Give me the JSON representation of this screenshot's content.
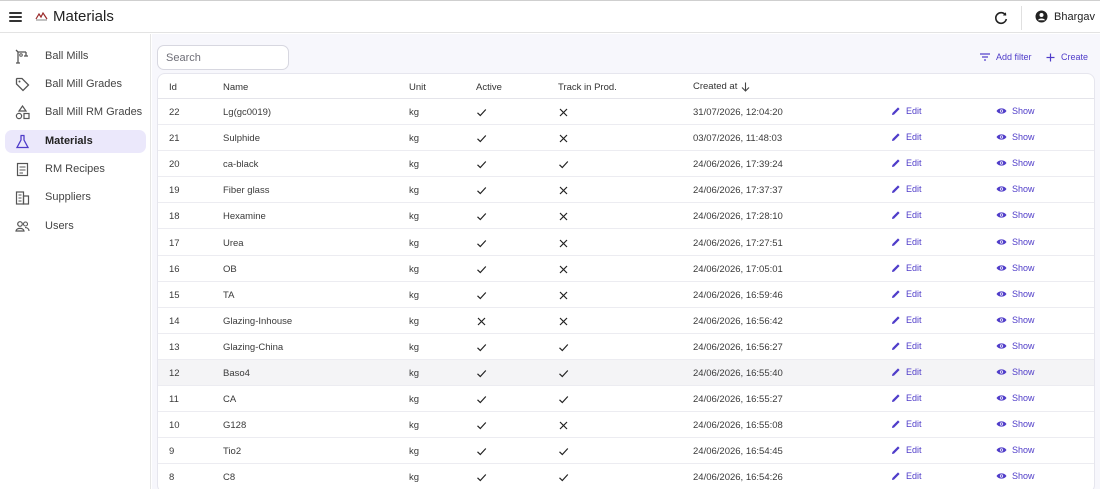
{
  "app": {
    "title": "Materials",
    "user": "Bhargav"
  },
  "sidebar": {
    "items": [
      {
        "label": "Ball Mills",
        "icon": "crane-icon",
        "active": false
      },
      {
        "label": "Ball Mill Grades",
        "icon": "tag-icon",
        "active": false
      },
      {
        "label": "Ball Mill RM Grades",
        "icon": "shapes-icon",
        "active": false
      },
      {
        "label": "Materials",
        "icon": "flask-icon",
        "active": true
      },
      {
        "label": "RM Recipes",
        "icon": "receipt-icon",
        "active": false
      },
      {
        "label": "Suppliers",
        "icon": "building-icon",
        "active": false
      },
      {
        "label": "Users",
        "icon": "people-icon",
        "active": false
      }
    ]
  },
  "search": {
    "placeholder": "Search",
    "value": ""
  },
  "toolbar": {
    "add_filter": "Add filter",
    "create": "Create"
  },
  "table": {
    "columns": {
      "id": "Id",
      "name": "Name",
      "unit": "Unit",
      "active": "Active",
      "track": "Track in Prod.",
      "created": "Created at"
    },
    "sort_column": "created",
    "sort_direction": "desc",
    "edit_label": "Edit",
    "show_label": "Show",
    "highlighted_row_id": "12",
    "rows": [
      {
        "id": "22",
        "name": "Lg(gc0019)",
        "unit": "kg",
        "active": true,
        "track": false,
        "created": "31/07/2026, 12:04:20"
      },
      {
        "id": "21",
        "name": "Sulphide",
        "unit": "kg",
        "active": true,
        "track": false,
        "created": "03/07/2026, 11:48:03"
      },
      {
        "id": "20",
        "name": "ca-black",
        "unit": "kg",
        "active": true,
        "track": true,
        "created": "24/06/2026, 17:39:24"
      },
      {
        "id": "19",
        "name": "Fiber glass",
        "unit": "kg",
        "active": true,
        "track": false,
        "created": "24/06/2026, 17:37:37"
      },
      {
        "id": "18",
        "name": "Hexamine",
        "unit": "kg",
        "active": true,
        "track": false,
        "created": "24/06/2026, 17:28:10"
      },
      {
        "id": "17",
        "name": "Urea",
        "unit": "kg",
        "active": true,
        "track": false,
        "created": "24/06/2026, 17:27:51"
      },
      {
        "id": "16",
        "name": "OB",
        "unit": "kg",
        "active": true,
        "track": false,
        "created": "24/06/2026, 17:05:01"
      },
      {
        "id": "15",
        "name": "TA",
        "unit": "kg",
        "active": true,
        "track": false,
        "created": "24/06/2026, 16:59:46"
      },
      {
        "id": "14",
        "name": "Glazing-Inhouse",
        "unit": "kg",
        "active": false,
        "track": false,
        "created": "24/06/2026, 16:56:42"
      },
      {
        "id": "13",
        "name": "Glazing-China",
        "unit": "kg",
        "active": true,
        "track": true,
        "created": "24/06/2026, 16:56:27"
      },
      {
        "id": "12",
        "name": "Baso4",
        "unit": "kg",
        "active": true,
        "track": true,
        "created": "24/06/2026, 16:55:40"
      },
      {
        "id": "11",
        "name": "CA",
        "unit": "kg",
        "active": true,
        "track": true,
        "created": "24/06/2026, 16:55:27"
      },
      {
        "id": "10",
        "name": "G128",
        "unit": "kg",
        "active": true,
        "track": false,
        "created": "24/06/2026, 16:55:08"
      },
      {
        "id": "9",
        "name": "Tio2",
        "unit": "kg",
        "active": true,
        "track": true,
        "created": "24/06/2026, 16:54:45"
      },
      {
        "id": "8",
        "name": "C8",
        "unit": "kg",
        "active": true,
        "track": true,
        "created": "24/06/2026, 16:54:26"
      }
    ]
  },
  "colors": {
    "accent": "#4f3cc9",
    "active_nav_bg": "#ebe8fb",
    "page_bg": "#f7f7fc"
  }
}
